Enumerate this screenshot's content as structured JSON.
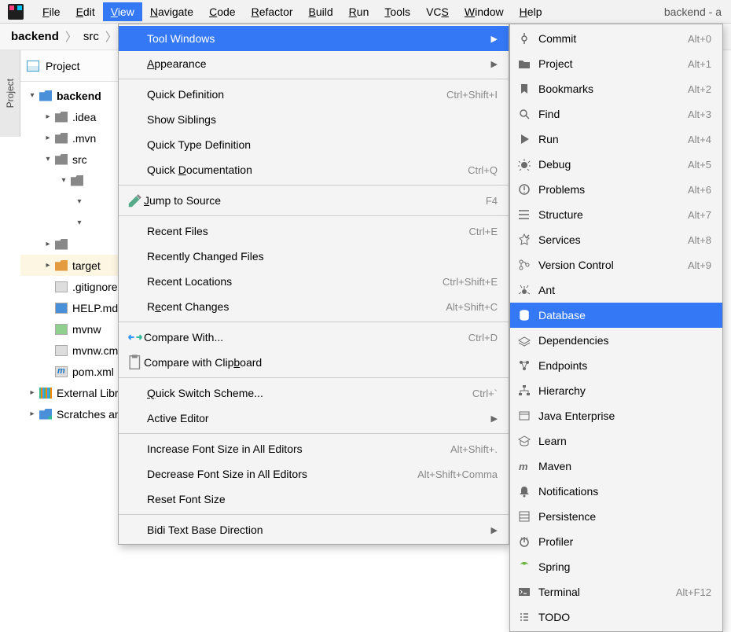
{
  "menubar": {
    "items": [
      "File",
      "Edit",
      "View",
      "Navigate",
      "Code",
      "Refactor",
      "Build",
      "Run",
      "Tools",
      "VCS",
      "Window",
      "Help"
    ],
    "title_right": "backend - a"
  },
  "breadcrumb": [
    "backend",
    "src"
  ],
  "side_tab": "Project",
  "panel": {
    "title": "Project"
  },
  "tree": [
    {
      "d": 0,
      "a": "open",
      "i": "folder blue",
      "l": "backend",
      "bold": true
    },
    {
      "d": 1,
      "a": "closed",
      "i": "folder",
      "l": ".idea"
    },
    {
      "d": 1,
      "a": "closed",
      "i": "folder",
      "l": ".mvn"
    },
    {
      "d": 1,
      "a": "open",
      "i": "folder",
      "l": "src"
    },
    {
      "d": 2,
      "a": "open",
      "i": "folder",
      "l": ""
    },
    {
      "d": 3,
      "a": "open",
      "i": "",
      "l": ""
    },
    {
      "d": 3,
      "a": "open",
      "i": "",
      "l": ""
    },
    {
      "d": 1,
      "a": "closed",
      "i": "folder",
      "l": ""
    },
    {
      "d": 1,
      "a": "closed",
      "i": "folder orange",
      "l": "target",
      "hl": true
    },
    {
      "d": 1,
      "a": "none",
      "i": "file",
      "l": ".gitignore"
    },
    {
      "d": 1,
      "a": "none",
      "i": "file md",
      "l": "HELP.md"
    },
    {
      "d": 1,
      "a": "none",
      "i": "file green",
      "l": "mvnw"
    },
    {
      "d": 1,
      "a": "none",
      "i": "file",
      "l": "mvnw.cmd"
    },
    {
      "d": 1,
      "a": "none",
      "i": "file m",
      "l": "pom.xml"
    },
    {
      "d": 0,
      "a": "closed",
      "i": "libs",
      "l": "External Libraries"
    },
    {
      "d": 0,
      "a": "closed",
      "i": "scratch",
      "l": "Scratches and Consoles"
    }
  ],
  "view_menu": [
    {
      "t": "item",
      "l": "Tool Windows",
      "sub": true,
      "sel": true,
      "indent": true
    },
    {
      "t": "item",
      "l": "Appearance",
      "sub": true,
      "indent": true,
      "mn": 0
    },
    {
      "t": "sep"
    },
    {
      "t": "item",
      "l": "Quick Definition",
      "sc": "Ctrl+Shift+I",
      "indent": true
    },
    {
      "t": "item",
      "l": "Show Siblings",
      "indent": true
    },
    {
      "t": "item",
      "l": "Quick Type Definition",
      "indent": true
    },
    {
      "t": "item",
      "l": "Quick Documentation",
      "sc": "Ctrl+Q",
      "indent": true,
      "mn": 6
    },
    {
      "t": "sep"
    },
    {
      "t": "item",
      "l": "Jump to Source",
      "sc": "F4",
      "lead": "edit",
      "mn": 0
    },
    {
      "t": "sep"
    },
    {
      "t": "item",
      "l": "Recent Files",
      "sc": "Ctrl+E",
      "indent": true
    },
    {
      "t": "item",
      "l": "Recently Changed Files",
      "indent": true
    },
    {
      "t": "item",
      "l": "Recent Locations",
      "sc": "Ctrl+Shift+E",
      "indent": true
    },
    {
      "t": "item",
      "l": "Recent Changes",
      "sc": "Alt+Shift+C",
      "indent": true,
      "mn": 1
    },
    {
      "t": "sep"
    },
    {
      "t": "item",
      "l": "Compare With...",
      "sc": "Ctrl+D",
      "lead": "cmp"
    },
    {
      "t": "item",
      "l": "Compare with Clipboard",
      "lead": "clip",
      "mn": 17
    },
    {
      "t": "sep"
    },
    {
      "t": "item",
      "l": "Quick Switch Scheme...",
      "sc": "Ctrl+`",
      "indent": true,
      "mn": 0
    },
    {
      "t": "item",
      "l": "Active Editor",
      "sub": true,
      "indent": true
    },
    {
      "t": "sep"
    },
    {
      "t": "item",
      "l": "Increase Font Size in All Editors",
      "sc": "Alt+Shift+.",
      "indent": true
    },
    {
      "t": "item",
      "l": "Decrease Font Size in All Editors",
      "sc": "Alt+Shift+Comma",
      "indent": true
    },
    {
      "t": "item",
      "l": "Reset Font Size",
      "indent": true
    },
    {
      "t": "sep"
    },
    {
      "t": "item",
      "l": "Bidi Text Base Direction",
      "sub": true,
      "indent": true
    }
  ],
  "tool_windows": [
    {
      "l": "Commit",
      "sc": "Alt+0",
      "i": "commit"
    },
    {
      "l": "Project",
      "sc": "Alt+1",
      "i": "folder"
    },
    {
      "l": "Bookmarks",
      "sc": "Alt+2",
      "i": "bookmark"
    },
    {
      "l": "Find",
      "sc": "Alt+3",
      "i": "find"
    },
    {
      "l": "Run",
      "sc": "Alt+4",
      "i": "run"
    },
    {
      "l": "Debug",
      "sc": "Alt+5",
      "i": "debug"
    },
    {
      "l": "Problems",
      "sc": "Alt+6",
      "i": "problems"
    },
    {
      "l": "Structure",
      "sc": "Alt+7",
      "i": "structure"
    },
    {
      "l": "Services",
      "sc": "Alt+8",
      "i": "services"
    },
    {
      "l": "Version Control",
      "sc": "Alt+9",
      "i": "vcs"
    },
    {
      "l": "Ant",
      "i": "ant"
    },
    {
      "l": "Database",
      "i": "database",
      "sel": true
    },
    {
      "l": "Dependencies",
      "i": "deps"
    },
    {
      "l": "Endpoints",
      "i": "endpoints"
    },
    {
      "l": "Hierarchy",
      "i": "hierarchy"
    },
    {
      "l": "Java Enterprise",
      "i": "jee"
    },
    {
      "l": "Learn",
      "i": "learn"
    },
    {
      "l": "Maven",
      "i": "maven"
    },
    {
      "l": "Notifications",
      "i": "notif"
    },
    {
      "l": "Persistence",
      "i": "persist"
    },
    {
      "l": "Profiler",
      "i": "profiler"
    },
    {
      "l": "Spring",
      "i": "spring"
    },
    {
      "l": "Terminal",
      "sc": "Alt+F12",
      "i": "terminal"
    },
    {
      "l": "TODO",
      "i": "todo"
    }
  ]
}
